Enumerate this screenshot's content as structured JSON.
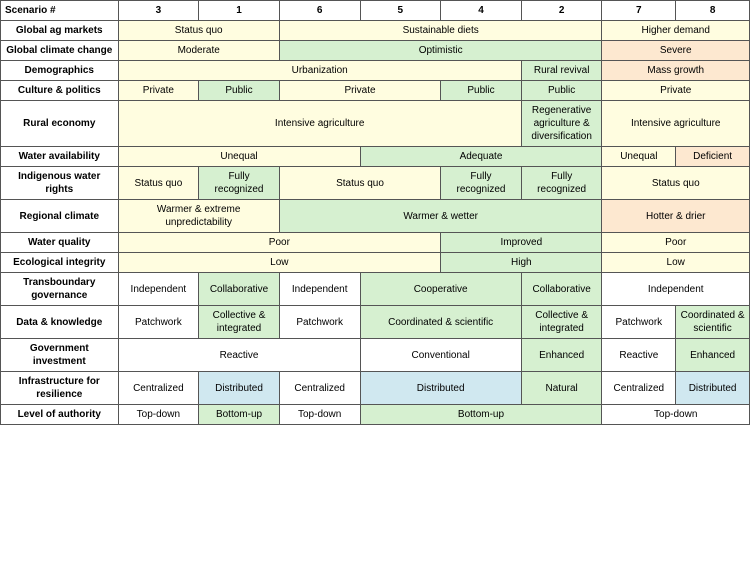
{
  "headers": {
    "scenario_label": "Scenario #",
    "cols": [
      "3",
      "1",
      "6",
      "5",
      "4",
      "2",
      "7",
      "8"
    ]
  },
  "rows": [
    {
      "label": "Global ag markets",
      "cells": [
        {
          "text": "Status quo",
          "colspan": 2,
          "rowspan": 1,
          "color": "c-yellow"
        },
        {
          "text": "Sustainable diets",
          "colspan": 4,
          "rowspan": 1,
          "color": "c-yellow"
        },
        {
          "text": "Higher demand",
          "colspan": 2,
          "rowspan": 1,
          "color": "c-yellow"
        }
      ]
    },
    {
      "label": "Global climate change",
      "cells": [
        {
          "text": "Moderate",
          "colspan": 2,
          "rowspan": 1,
          "color": "c-yellow"
        },
        {
          "text": "Optimistic",
          "colspan": 4,
          "rowspan": 1,
          "color": "c-green"
        },
        {
          "text": "Severe",
          "colspan": 2,
          "rowspan": 1,
          "color": "c-peach"
        }
      ]
    },
    {
      "label": "Demographics",
      "cells": [
        {
          "text": "Urbanization",
          "colspan": 5,
          "rowspan": 1,
          "color": "c-yellow"
        },
        {
          "text": "Rural revival",
          "colspan": 1,
          "rowspan": 1,
          "color": "c-green"
        },
        {
          "text": "Mass growth",
          "colspan": 2,
          "rowspan": 1,
          "color": "c-peach"
        }
      ]
    },
    {
      "label": "Culture & politics",
      "cells": [
        {
          "text": "Private",
          "colspan": 1,
          "rowspan": 1,
          "color": "c-yellow"
        },
        {
          "text": "Public",
          "colspan": 1,
          "rowspan": 1,
          "color": "c-green"
        },
        {
          "text": "Private",
          "colspan": 2,
          "rowspan": 1,
          "color": "c-yellow"
        },
        {
          "text": "Public",
          "colspan": 1,
          "rowspan": 1,
          "color": "c-green"
        },
        {
          "text": "Public",
          "colspan": 1,
          "rowspan": 1,
          "color": "c-green"
        },
        {
          "text": "Private",
          "colspan": 2,
          "rowspan": 1,
          "color": "c-yellow"
        }
      ]
    },
    {
      "label": "Rural economy",
      "cells": [
        {
          "text": "Intensive agriculture",
          "colspan": 5,
          "rowspan": 1,
          "color": "c-yellow"
        },
        {
          "text": "Regenerative agriculture & diversification",
          "colspan": 1,
          "rowspan": 1,
          "color": "c-green"
        },
        {
          "text": "Intensive agriculture",
          "colspan": 2,
          "rowspan": 1,
          "color": "c-yellow"
        }
      ]
    },
    {
      "label": "Water availability",
      "cells": [
        {
          "text": "Unequal",
          "colspan": 3,
          "rowspan": 1,
          "color": "c-yellow"
        },
        {
          "text": "Adequate",
          "colspan": 3,
          "rowspan": 1,
          "color": "c-green"
        },
        {
          "text": "Unequal",
          "colspan": 1,
          "rowspan": 1,
          "color": "c-yellow"
        },
        {
          "text": "Deficient",
          "colspan": 1,
          "rowspan": 1,
          "color": "c-peach"
        }
      ]
    },
    {
      "label": "Indigenous water rights",
      "cells": [
        {
          "text": "Status quo",
          "colspan": 1,
          "rowspan": 1,
          "color": "c-yellow"
        },
        {
          "text": "Fully recognized",
          "colspan": 1,
          "rowspan": 1,
          "color": "c-green"
        },
        {
          "text": "Status quo",
          "colspan": 2,
          "rowspan": 1,
          "color": "c-yellow"
        },
        {
          "text": "Fully recognized",
          "colspan": 1,
          "rowspan": 1,
          "color": "c-green"
        },
        {
          "text": "Fully recognized",
          "colspan": 1,
          "rowspan": 1,
          "color": "c-green"
        },
        {
          "text": "Status quo",
          "colspan": 2,
          "rowspan": 1,
          "color": "c-yellow"
        }
      ]
    },
    {
      "label": "Regional climate",
      "cells": [
        {
          "text": "Warmer & extreme unpredictability",
          "colspan": 2,
          "rowspan": 1,
          "color": "c-yellow"
        },
        {
          "text": "Warmer & wetter",
          "colspan": 4,
          "rowspan": 1,
          "color": "c-green"
        },
        {
          "text": "Hotter & drier",
          "colspan": 2,
          "rowspan": 1,
          "color": "c-peach"
        }
      ]
    },
    {
      "label": "Water quality",
      "cells": [
        {
          "text": "Poor",
          "colspan": 4,
          "rowspan": 1,
          "color": "c-yellow"
        },
        {
          "text": "Improved",
          "colspan": 2,
          "rowspan": 1,
          "color": "c-green"
        },
        {
          "text": "Poor",
          "colspan": 2,
          "rowspan": 1,
          "color": "c-yellow"
        }
      ]
    },
    {
      "label": "Ecological integrity",
      "cells": [
        {
          "text": "Low",
          "colspan": 4,
          "rowspan": 1,
          "color": "c-yellow"
        },
        {
          "text": "High",
          "colspan": 2,
          "rowspan": 1,
          "color": "c-green"
        },
        {
          "text": "Low",
          "colspan": 2,
          "rowspan": 1,
          "color": "c-yellow"
        }
      ]
    },
    {
      "label": "Transboundary governance",
      "cells": [
        {
          "text": "Independent",
          "colspan": 1,
          "rowspan": 1,
          "color": "c-white"
        },
        {
          "text": "Collaborative",
          "colspan": 1,
          "rowspan": 1,
          "color": "c-green"
        },
        {
          "text": "Independent",
          "colspan": 1,
          "rowspan": 1,
          "color": "c-white"
        },
        {
          "text": "Cooperative",
          "colspan": 2,
          "rowspan": 1,
          "color": "c-green"
        },
        {
          "text": "Collaborative",
          "colspan": 1,
          "rowspan": 1,
          "color": "c-green"
        },
        {
          "text": "Independent",
          "colspan": 2,
          "rowspan": 1,
          "color": "c-white"
        }
      ]
    },
    {
      "label": "Data & knowledge",
      "cells": [
        {
          "text": "Patchwork",
          "colspan": 1,
          "rowspan": 1,
          "color": "c-white"
        },
        {
          "text": "Collective & integrated",
          "colspan": 1,
          "rowspan": 1,
          "color": "c-green"
        },
        {
          "text": "Patchwork",
          "colspan": 1,
          "rowspan": 1,
          "color": "c-white"
        },
        {
          "text": "Coordinated & scientific",
          "colspan": 2,
          "rowspan": 1,
          "color": "c-green"
        },
        {
          "text": "Collective & integrated",
          "colspan": 1,
          "rowspan": 1,
          "color": "c-green"
        },
        {
          "text": "Patchwork",
          "colspan": 1,
          "rowspan": 1,
          "color": "c-white"
        },
        {
          "text": "Coordinated & scientific",
          "colspan": 1,
          "rowspan": 1,
          "color": "c-green"
        }
      ]
    },
    {
      "label": "Government investment",
      "cells": [
        {
          "text": "Reactive",
          "colspan": 3,
          "rowspan": 1,
          "color": "c-white"
        },
        {
          "text": "Conventional",
          "colspan": 2,
          "rowspan": 1,
          "color": "c-white"
        },
        {
          "text": "Enhanced",
          "colspan": 1,
          "rowspan": 1,
          "color": "c-green"
        },
        {
          "text": "Reactive",
          "colspan": 1,
          "rowspan": 1,
          "color": "c-white"
        },
        {
          "text": "Enhanced",
          "colspan": 1,
          "rowspan": 1,
          "color": "c-green"
        }
      ]
    },
    {
      "label": "Infrastructure for resilience",
      "cells": [
        {
          "text": "Centralized",
          "colspan": 1,
          "rowspan": 1,
          "color": "c-white"
        },
        {
          "text": "Distributed",
          "colspan": 1,
          "rowspan": 1,
          "color": "c-blue"
        },
        {
          "text": "Centralized",
          "colspan": 1,
          "rowspan": 1,
          "color": "c-white"
        },
        {
          "text": "Distributed",
          "colspan": 2,
          "rowspan": 1,
          "color": "c-blue"
        },
        {
          "text": "Natural",
          "colspan": 1,
          "rowspan": 1,
          "color": "c-green"
        },
        {
          "text": "Centralized",
          "colspan": 1,
          "rowspan": 1,
          "color": "c-white"
        },
        {
          "text": "Distributed",
          "colspan": 1,
          "rowspan": 1,
          "color": "c-blue"
        }
      ]
    },
    {
      "label": "Level of authority",
      "cells": [
        {
          "text": "Top-down",
          "colspan": 1,
          "rowspan": 1,
          "color": "c-white"
        },
        {
          "text": "Bottom-up",
          "colspan": 1,
          "rowspan": 1,
          "color": "c-green"
        },
        {
          "text": "Top-down",
          "colspan": 1,
          "rowspan": 1,
          "color": "c-white"
        },
        {
          "text": "Bottom-up",
          "colspan": 3,
          "rowspan": 1,
          "color": "c-green"
        },
        {
          "text": "Top-down",
          "colspan": 2,
          "rowspan": 1,
          "color": "c-white"
        }
      ]
    }
  ],
  "extra_labels": {
    "collaborative_collective": "Collaborative Collective",
    "distributed": "Distributed",
    "data_knowledge_gov": "Data knowledge Government investment",
    "demographics": "Demographics",
    "cooperative": "Cooperative"
  }
}
